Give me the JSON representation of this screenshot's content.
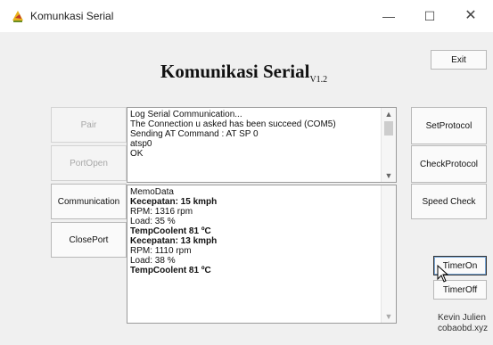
{
  "window": {
    "title": "Komunkasi Serial",
    "controls": {
      "minimize": "—",
      "maximize": "☐",
      "close": "✕"
    }
  },
  "header": {
    "title": "Komunikasi Serial",
    "version": "V1.2"
  },
  "buttons": {
    "exit": "Exit",
    "pair": "Pair",
    "port_open": "PortOpen",
    "communication": "Communication",
    "close_port": "ClosePort",
    "set_protocol": "SetProtocol",
    "check_protocol": "CheckProtocol",
    "speed_check": "Speed Check",
    "timer_on": "TimerOn",
    "timer_off": "TimerOff"
  },
  "log": {
    "lines": [
      "Log Serial Communication...",
      "The Connection u asked has been succeed (COM5)",
      "Sending AT Command : AT SP 0",
      "atsp0",
      "OK"
    ]
  },
  "memo": {
    "lines": [
      {
        "text": "MemoData",
        "bold": false
      },
      {
        "text": "Kecepatan: 15 kmph",
        "bold": true
      },
      {
        "text": "RPM: 1316 rpm",
        "bold": false
      },
      {
        "text": "Load: 35 %",
        "bold": false
      },
      {
        "text": "TempCoolent 81 ºC",
        "bold": true
      },
      {
        "text": "Kecepatan: 13 kmph",
        "bold": true
      },
      {
        "text": "RPM: 1110 rpm",
        "bold": false
      },
      {
        "text": "Load: 38 %",
        "bold": false
      },
      {
        "text": "TempCoolent 81 ºC",
        "bold": true
      }
    ]
  },
  "signature": {
    "name": "Kevin Julien",
    "site": "cobaobd.xyz"
  },
  "scroll": {
    "up": "▲",
    "down": "▼"
  }
}
